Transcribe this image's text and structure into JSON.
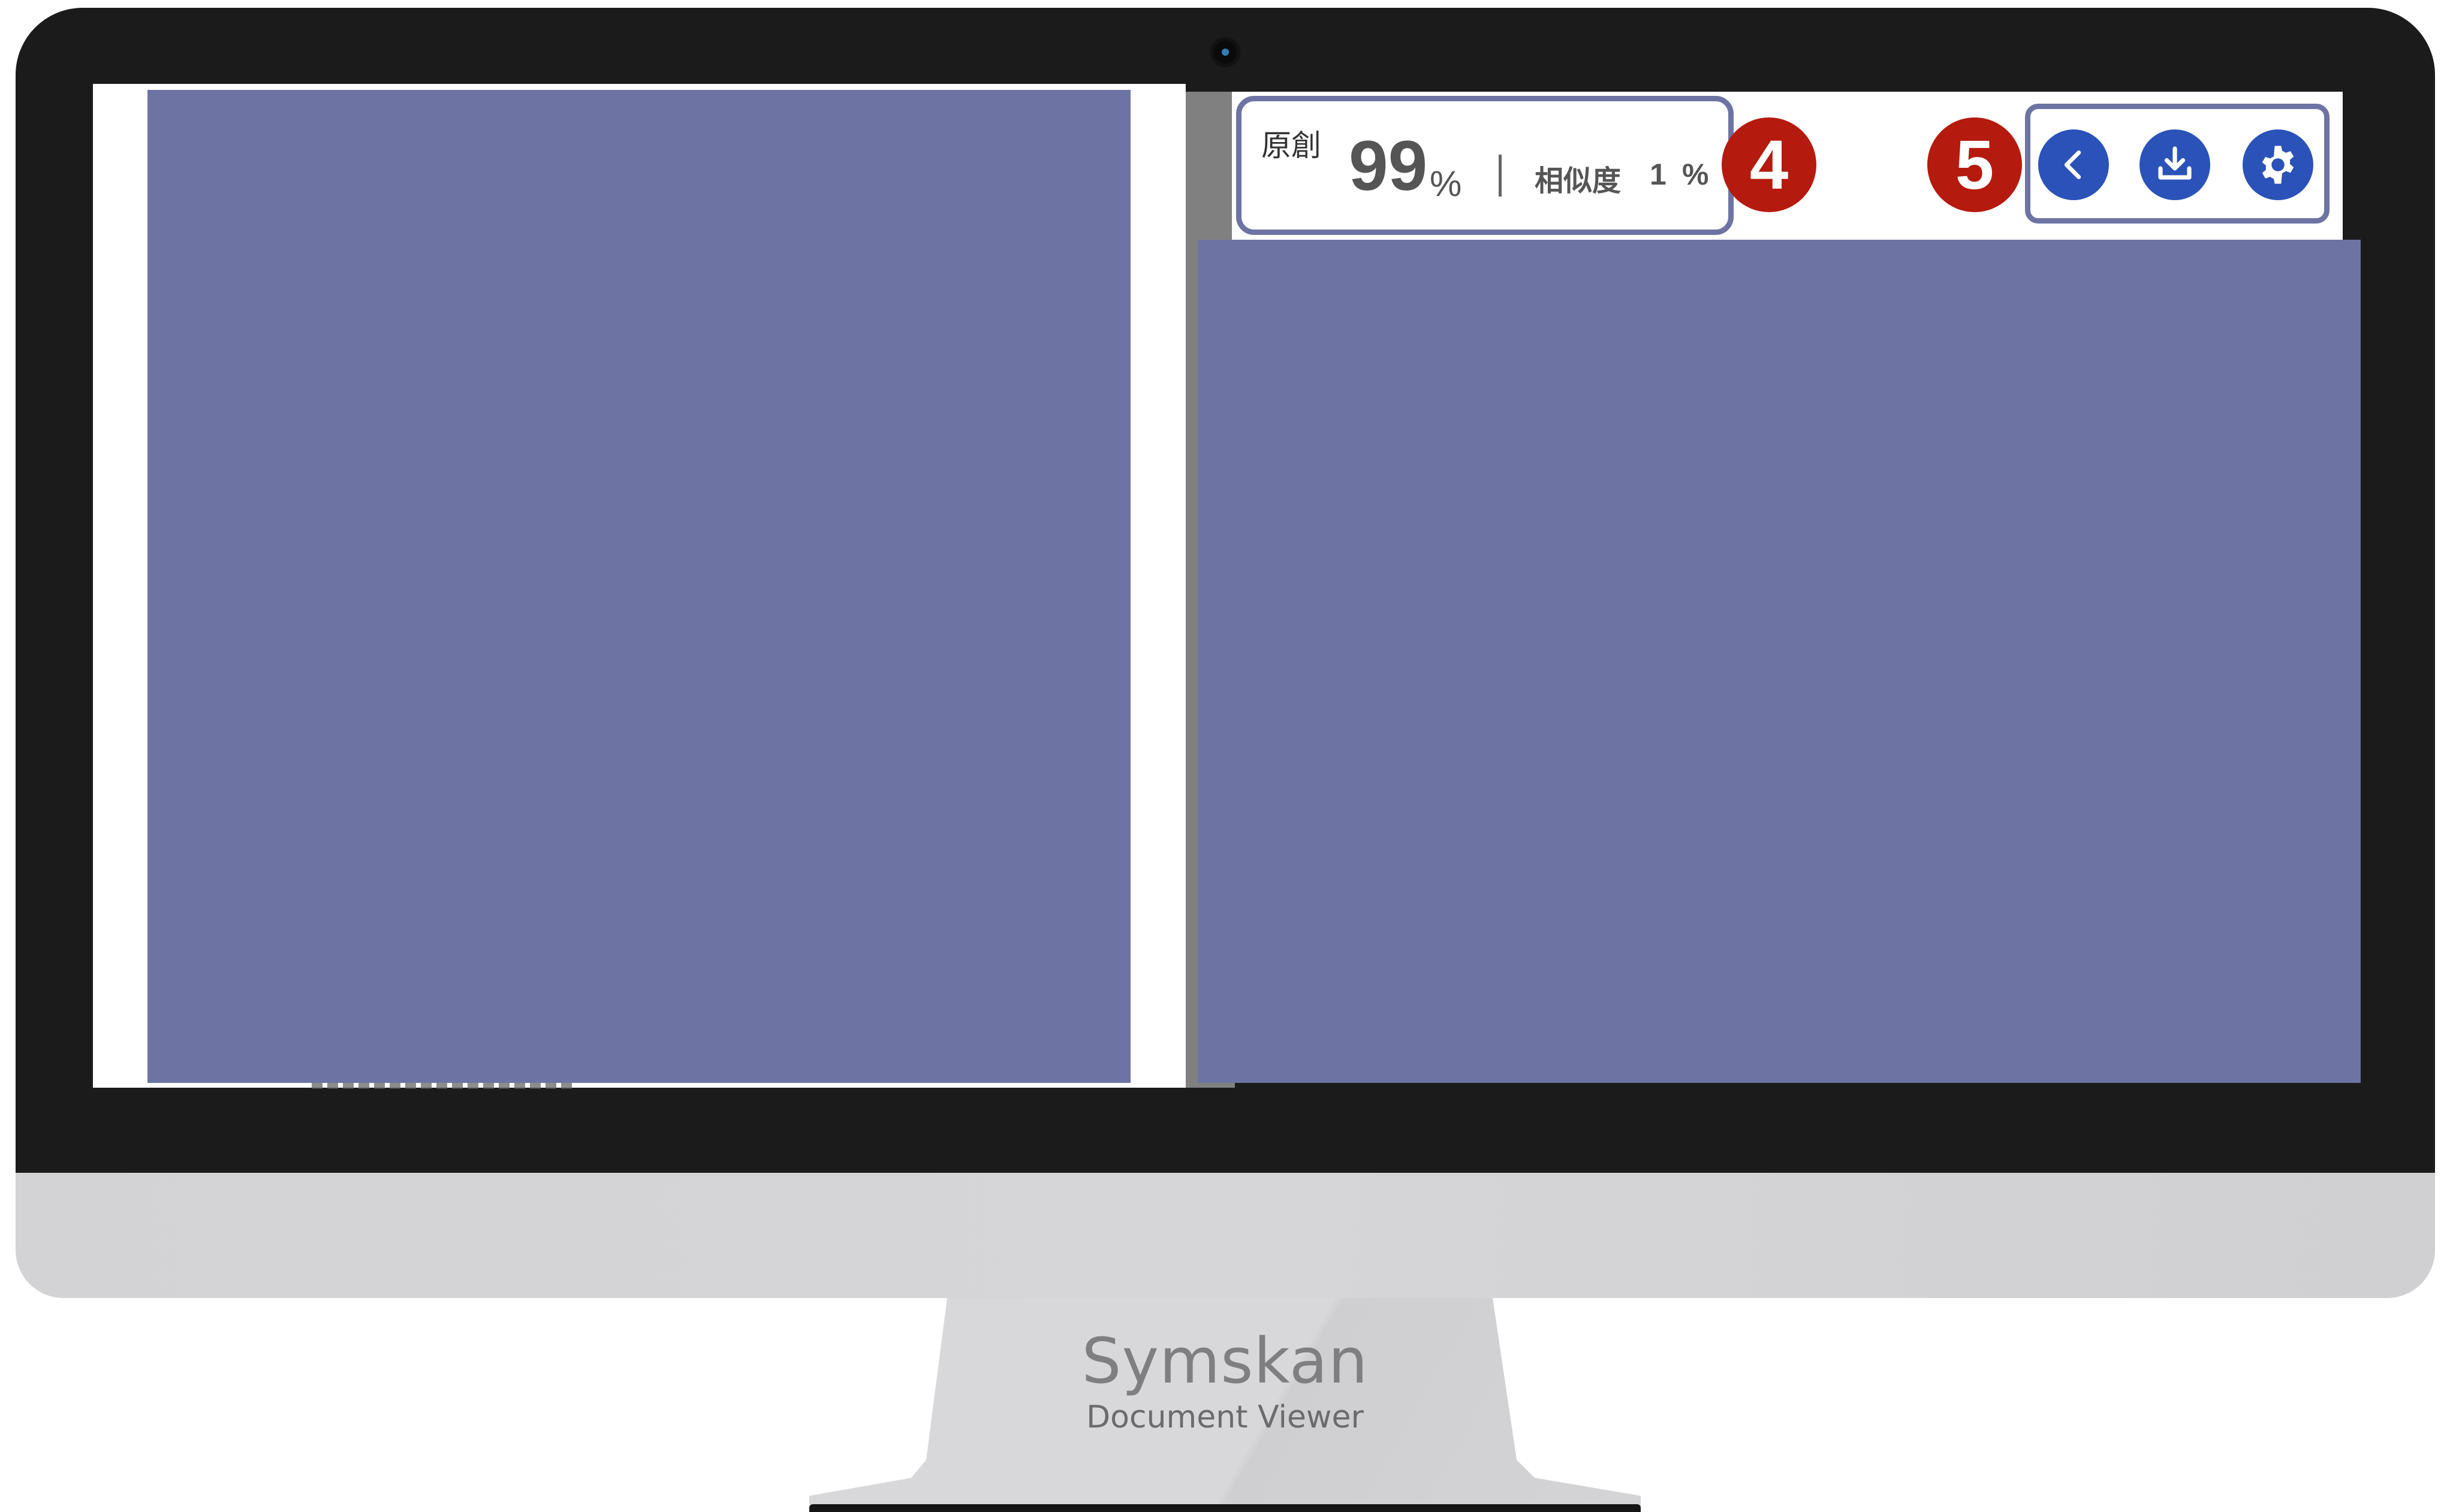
{
  "app": {
    "brand": "Symskan",
    "subtitle": "Document Viewer"
  },
  "score": {
    "original_label": "原創",
    "original_value": "99",
    "original_unit": "%",
    "similarity_label": "相似度",
    "similarity_value": "1",
    "similarity_unit": "%"
  },
  "callouts": {
    "score_panel": "4",
    "toolbar": "5"
  },
  "toolbar": {
    "buttons": [
      {
        "icon": "chevron-left-icon",
        "action": "back"
      },
      {
        "icon": "download-icon",
        "action": "download"
      },
      {
        "icon": "gear-icon",
        "action": "settings"
      }
    ]
  },
  "colors": {
    "placeholder_fill": "#6d74a3",
    "button_blue": "#2a52b8",
    "callout_red": "#b51a0e",
    "bezel": "#1b1b1b"
  }
}
